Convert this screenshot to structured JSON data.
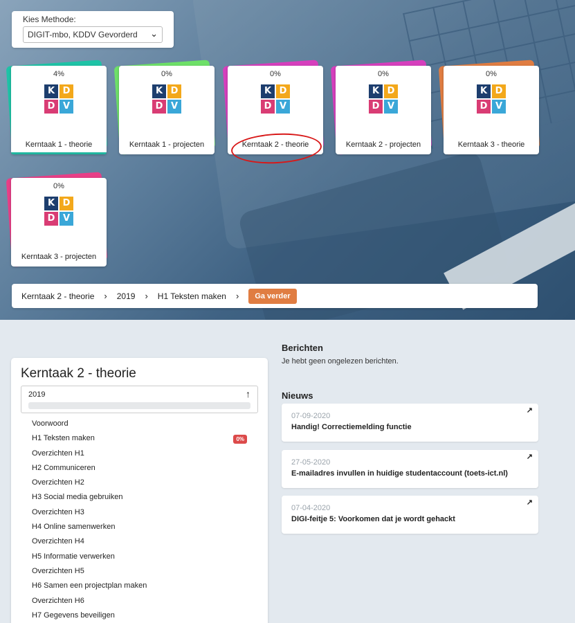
{
  "method": {
    "label": "Kies Methode:",
    "selected": "DIGIT-mbo, KDDV Gevorderd"
  },
  "logo": {
    "k": "K",
    "d": "D",
    "d2": "D",
    "v": "V"
  },
  "cards": [
    {
      "pct": "4%",
      "name": "Kerntaak 1 - theorie",
      "back_color": "#1ec3a6",
      "progress": 0.04
    },
    {
      "pct": "0%",
      "name": "Kerntaak 1 - projecten",
      "back_color": "#6ee068"
    },
    {
      "pct": "0%",
      "name": "Kerntaak 2 - theorie",
      "back_color": "#d63fbd"
    },
    {
      "pct": "0%",
      "name": "Kerntaak 2 - projecten",
      "back_color": "#d63fbd"
    },
    {
      "pct": "0%",
      "name": "Kerntaak 3 - theorie",
      "back_color": "#e07d42"
    },
    {
      "pct": "0%",
      "name": "Kerntaak 3 - projecten",
      "back_color": "#e83f87"
    }
  ],
  "breadcrumb": {
    "items": [
      "Kerntaak 2 - theorie",
      "2019",
      "H1 Teksten maken"
    ],
    "go": "Ga verder"
  },
  "panel": {
    "title": "Kerntaak 2 - theorie",
    "year": "2019",
    "chapters": [
      "Voorwoord",
      "H1 Teksten maken",
      "Overzichten H1",
      "H2 Communiceren",
      "Overzichten H2",
      "H3 Social media gebruiken",
      "Overzichten H3",
      "H4 Online samenwerken",
      "Overzichten H4",
      "H5 Informatie verwerken",
      "Overzichten H5",
      "H6 Samen een projectplan maken",
      "Overzichten H6",
      "H7 Gegevens beveiligen"
    ],
    "badge": "0%"
  },
  "messages": {
    "title": "Berichten",
    "text": "Je hebt geen ongelezen berichten."
  },
  "news": {
    "title": "Nieuws",
    "items": [
      {
        "date": "07-09-2020",
        "headline": "Handig! Correctiemelding functie"
      },
      {
        "date": "27-05-2020",
        "headline": "E-mailadres invullen in huidige studentaccount (toets-ict.nl)"
      },
      {
        "date": "07-04-2020",
        "headline": "DIGI-feitje 5: Voorkomen dat je wordt gehackt"
      }
    ]
  },
  "icons": {
    "dropdown": "chevron-down-icon",
    "collapse": "arrow-up-icon",
    "breadcrumb_sep": "chevron-right-icon",
    "external": "external-link-icon"
  }
}
